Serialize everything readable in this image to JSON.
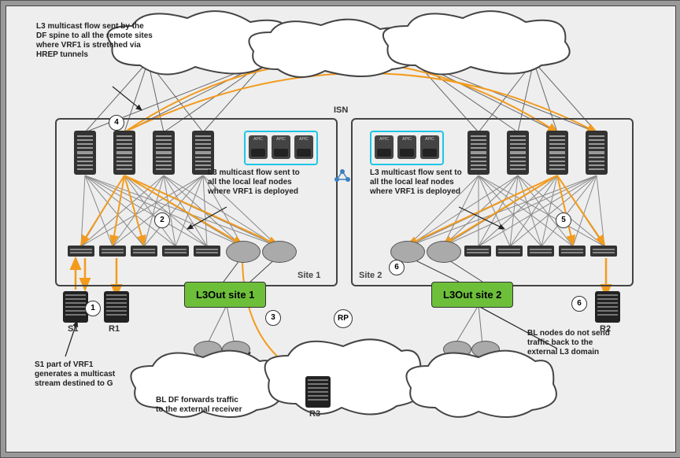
{
  "top_label": "ISN",
  "site1_name": "Site 1",
  "site2_name": "Site 2",
  "l3out1": "L3Out site 1",
  "l3out2": "L3Out site 2",
  "apic_label": "APIC",
  "devices": {
    "S1": "S1",
    "R1": "R1",
    "R2": "R2",
    "R3": "R3",
    "RP": "RP"
  },
  "annotations": {
    "a4": "L3 multicast flow sent by the DF spine to all the remote sites where VRF1 is stretched via HREP tunnels",
    "a2a": "L3 multicast flow sent to all the local leaf nodes where VRF1 is deployed",
    "a2b": "L3 multicast flow sent to all the local leaf nodes where VRF1 is deployed",
    "a1": "S1 part of VRF1 generates a multicast stream destined to G",
    "a3": "BL DF forwards traffic to the external receiver",
    "a6": "BL nodes do not send traffic back to the external L3 domain"
  },
  "steps": {
    "s1": "1",
    "s2": "2",
    "s3": "3",
    "s4": "4",
    "s5": "5",
    "s6a": "6",
    "s6b": "6"
  }
}
